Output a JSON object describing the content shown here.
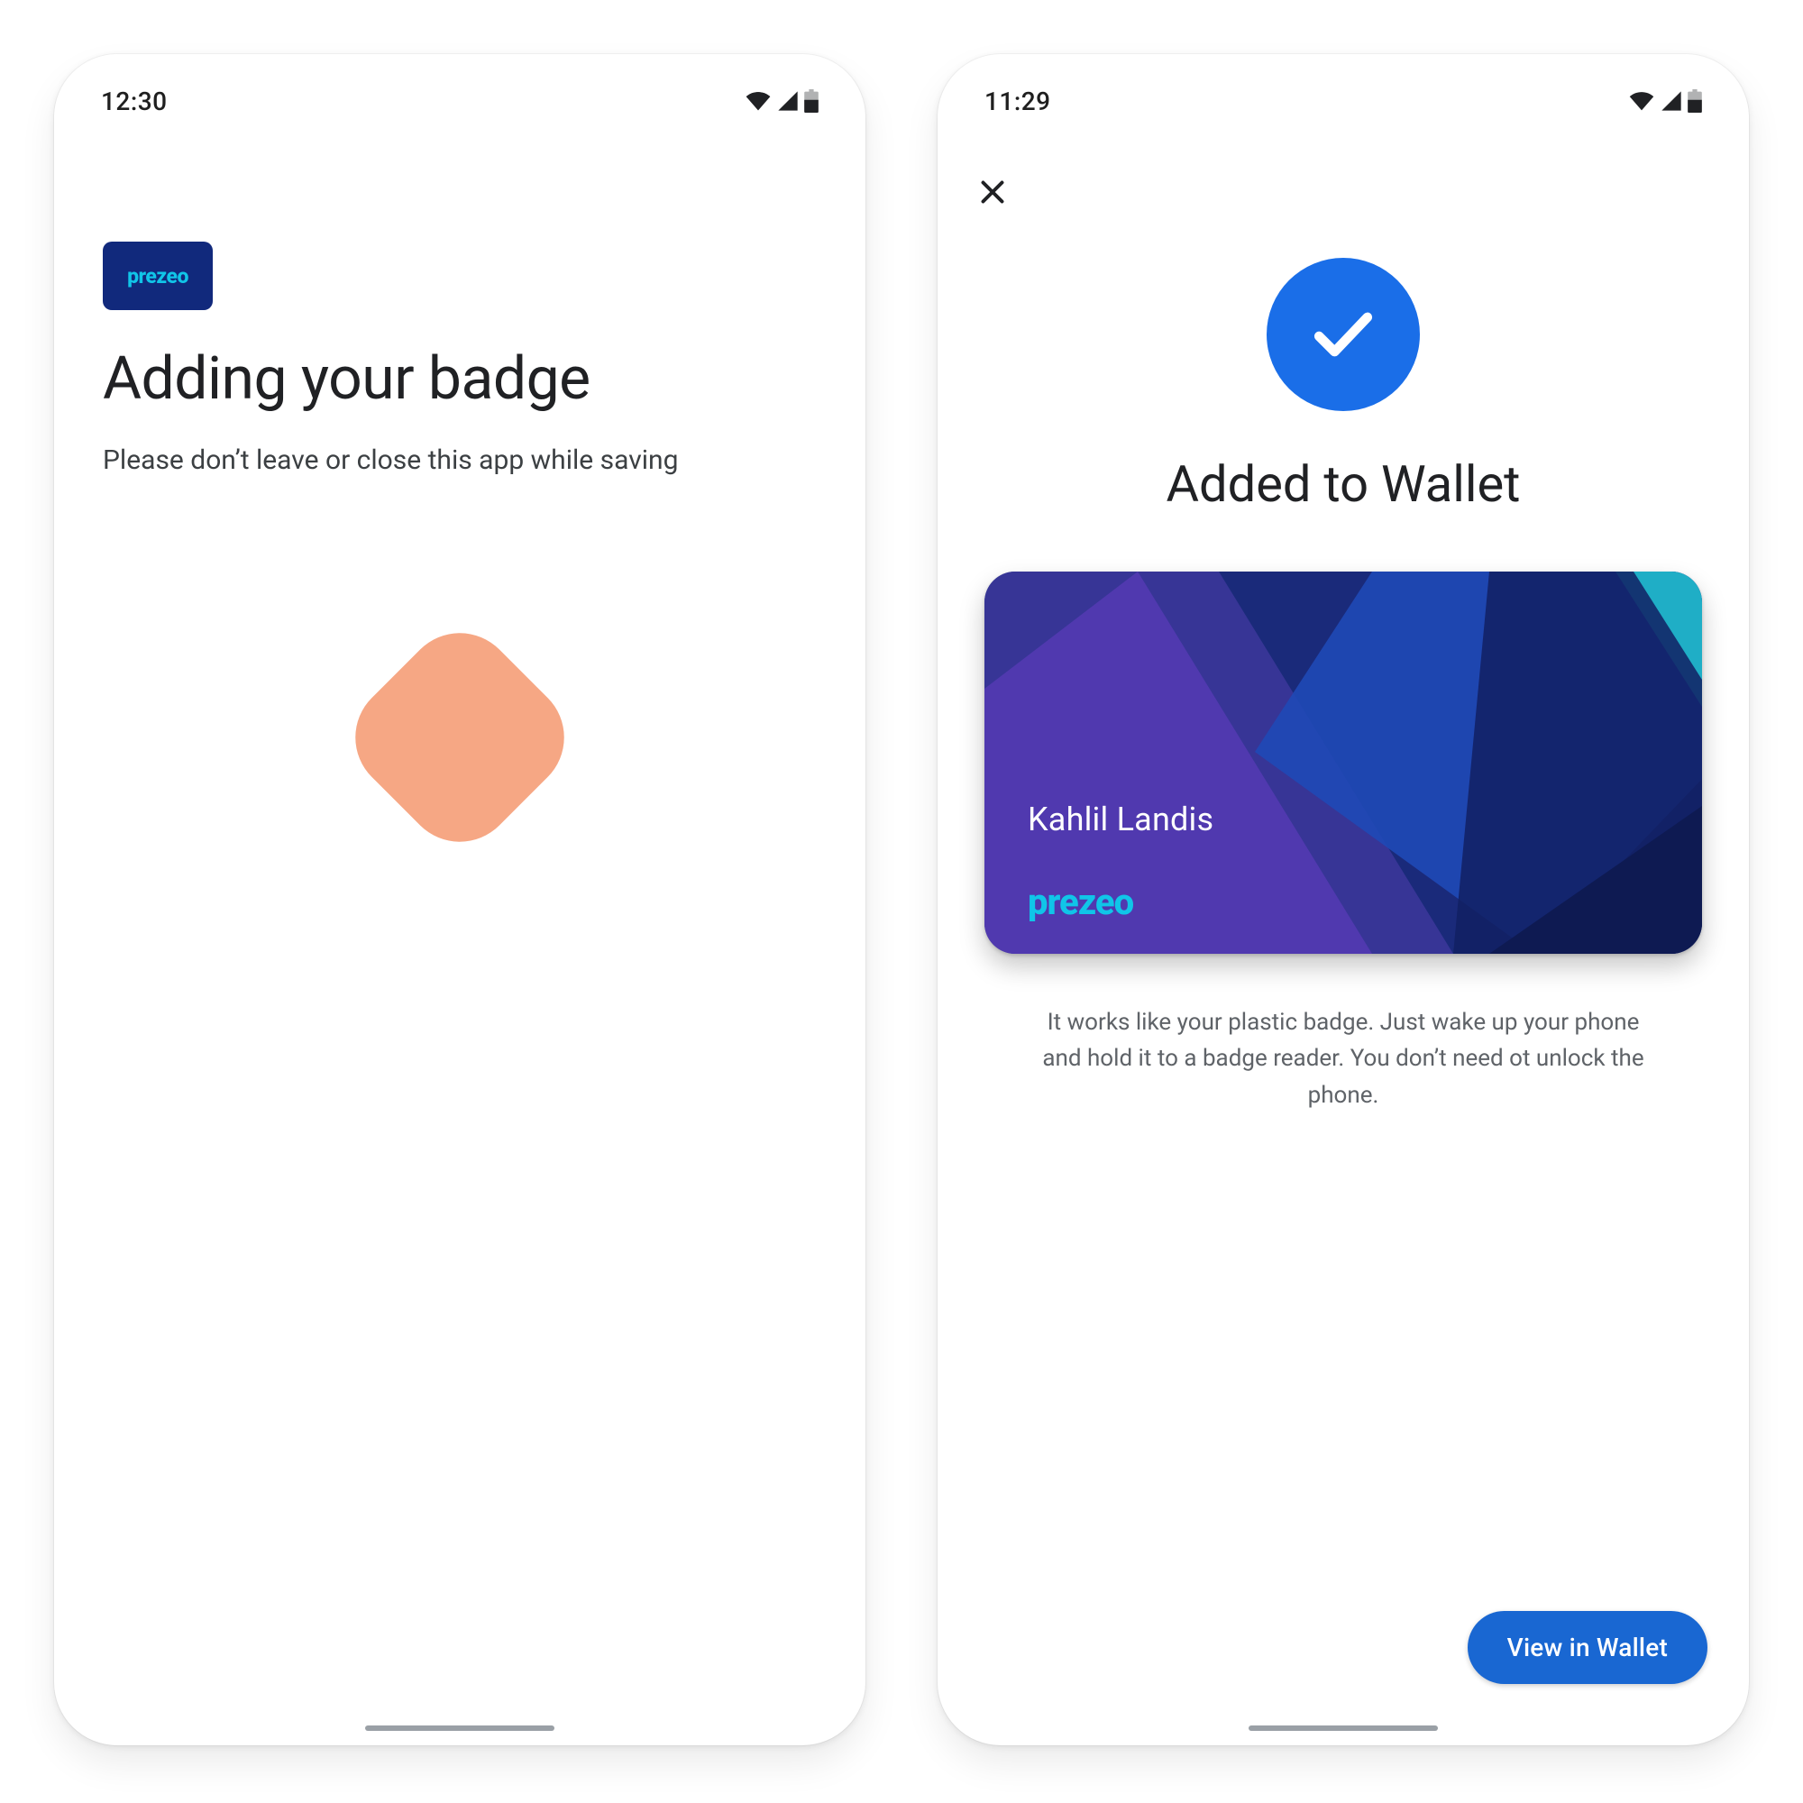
{
  "left": {
    "status_time": "12:30",
    "brand": "prezeo",
    "title": "Adding your badge",
    "subtitle": "Please don’t leave or close this app while saving"
  },
  "right": {
    "status_time": "11:29",
    "title": "Added to Wallet",
    "card": {
      "holder": "Kahlil Landis",
      "brand": "prezeo"
    },
    "description": "It works like your plastic badge. Just wake up your phone and hold it to a badge reader. You don’t need ot unlock the phone.",
    "cta": "View in Wallet"
  },
  "colors": {
    "primary_blue": "#1a73e8",
    "loader_peach": "#f6a784",
    "brand_cyan": "#10c5e8",
    "brand_navy": "#11297c"
  }
}
